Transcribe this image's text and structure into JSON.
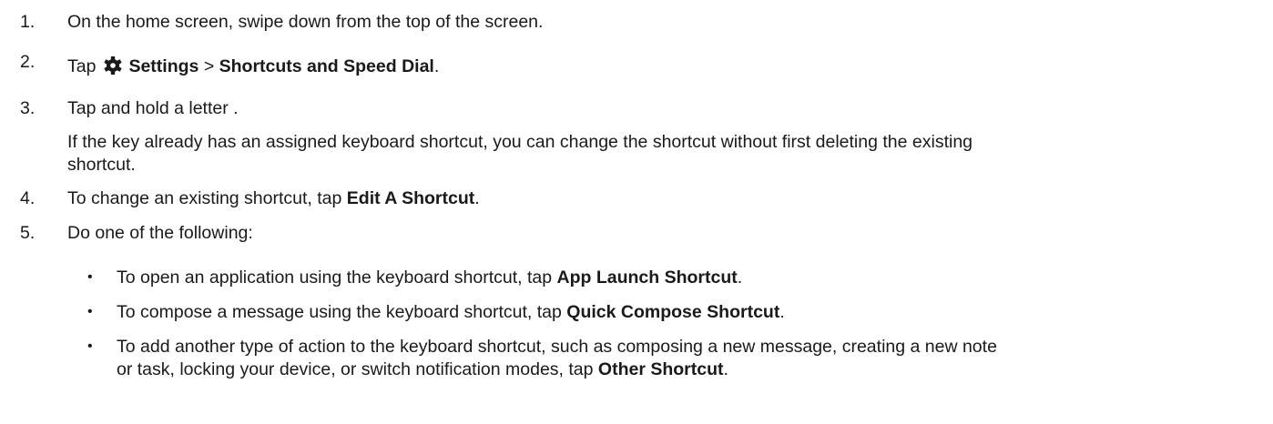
{
  "steps": [
    {
      "number": "1.",
      "text": "On the home screen, swipe down from the top of the screen."
    },
    {
      "number": "2.",
      "prefix": "Tap",
      "icon": "gear-icon",
      "settings": "Settings",
      "sep": ">",
      "target": "Shortcuts and Speed Dial",
      "end": "."
    },
    {
      "number": "3.",
      "text": "Tap and hold a letter .",
      "note_line1": "If the key already has an assigned keyboard shortcut, you can change the shortcut without first deleting the existing",
      "note_line2": "shortcut."
    },
    {
      "number": "4.",
      "prefix": "To change an existing shortcut, tap",
      "bold": "Edit A Shortcut",
      "end": "."
    },
    {
      "number": "5.",
      "text": "Do one of the following:"
    }
  ],
  "options": [
    {
      "bullet": "•",
      "prefix": "To open an application using the keyboard shortcut, tap",
      "bold": "App Launch Shortcut",
      "end": "."
    },
    {
      "bullet": "•",
      "prefix": "To compose a message using the keyboard shortcut, tap",
      "bold": "Quick Compose Shortcut",
      "end": "."
    },
    {
      "bullet": "•",
      "prefix_line1": "To add another type of action to the keyboard shortcut, such as composing a new message, creating a new note",
      "prefix_line2": "or task, locking your device, or switch notification modes, tap",
      "bold": "Other Shortcut",
      "end": "."
    }
  ]
}
